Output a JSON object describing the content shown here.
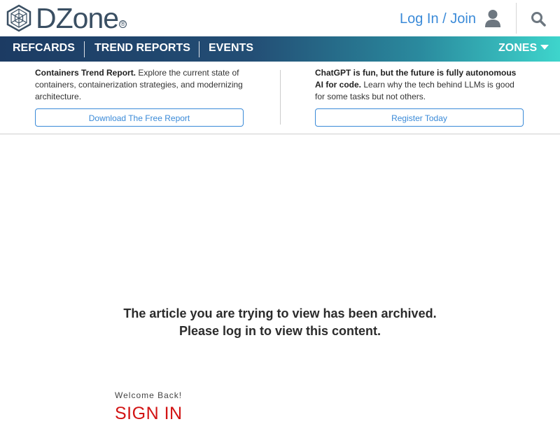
{
  "header": {
    "logo_text": "DZone",
    "logo_mark": "®",
    "login_label": "Log In / Join",
    "user_icon": "user-icon",
    "search_icon": "search-icon"
  },
  "nav": {
    "items": [
      {
        "label": "REFCARDS"
      },
      {
        "label": "TREND REPORTS"
      },
      {
        "label": "EVENTS"
      }
    ],
    "zones_label": "ZONES",
    "gradient": [
      "#1c3b63",
      "#3ed5cc"
    ]
  },
  "promos": [
    {
      "title": "Containers Trend Report.",
      "text": "Explore the current state of containers, containerization strategies, and modernizing architecture.",
      "button": "Download The Free Report"
    },
    {
      "title": "ChatGPT is fun, but the future is fully autonomous AI for code.",
      "text": "Learn why the tech behind LLMs is good for some tasks but not others.",
      "button": "Register Today"
    }
  ],
  "main": {
    "archived_line1": "The article you are trying to view has been archived.",
    "archived_line2": "Please log in to view this content.",
    "welcome": "Welcome Back!",
    "signin": "SIGN IN"
  },
  "colors": {
    "link": "#3a8ad8",
    "signin": "#d21414",
    "logo": "#3a4f63"
  }
}
